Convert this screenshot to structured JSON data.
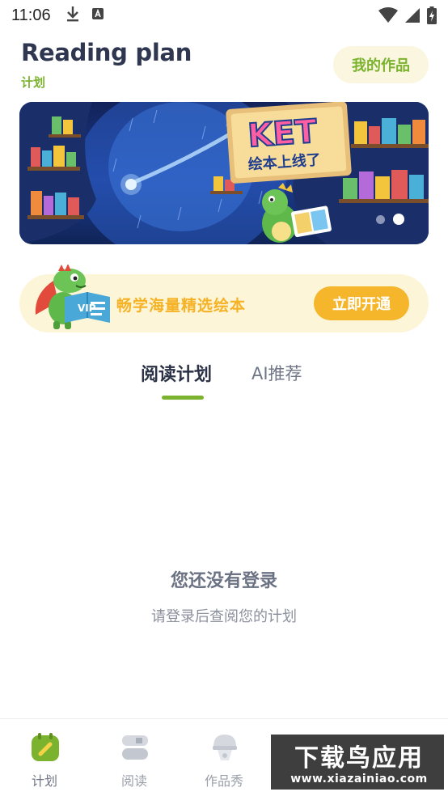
{
  "status_bar": {
    "time": "11:06",
    "icons": [
      "download-icon",
      "text-a-icon",
      "wifi-icon",
      "signal-icon",
      "battery-charging-icon"
    ]
  },
  "header": {
    "title": "Reading plan",
    "subtitle": "计划",
    "my_works_label": "我的作品"
  },
  "banner": {
    "headline": "KET",
    "subline": "绘本上线了",
    "slide_count": 2,
    "active_slide": 2
  },
  "vip_promo": {
    "text": "畅学海量精选绘本",
    "button_label": "立即开通",
    "badge": "VIP"
  },
  "tabs": [
    {
      "label": "阅读计划",
      "active": true
    },
    {
      "label": "AI推荐",
      "active": false
    }
  ],
  "empty_state": {
    "title": "您还没有登录",
    "description": "请登录后查阅您的计划"
  },
  "bottom_nav": [
    {
      "label": "计划",
      "icon": "calendar-icon",
      "active": true
    },
    {
      "label": "阅读",
      "icon": "books-icon",
      "active": false
    },
    {
      "label": "作品秀",
      "icon": "lamp-icon",
      "active": false
    }
  ],
  "watermark": {
    "main": "下载鸟应用",
    "url": "www.xiazainiao.com"
  },
  "colors": {
    "accent_green": "#7cb32e",
    "vip_orange": "#f5b62b",
    "vip_bg": "#fdf5d8",
    "title_dark": "#2e3650"
  }
}
